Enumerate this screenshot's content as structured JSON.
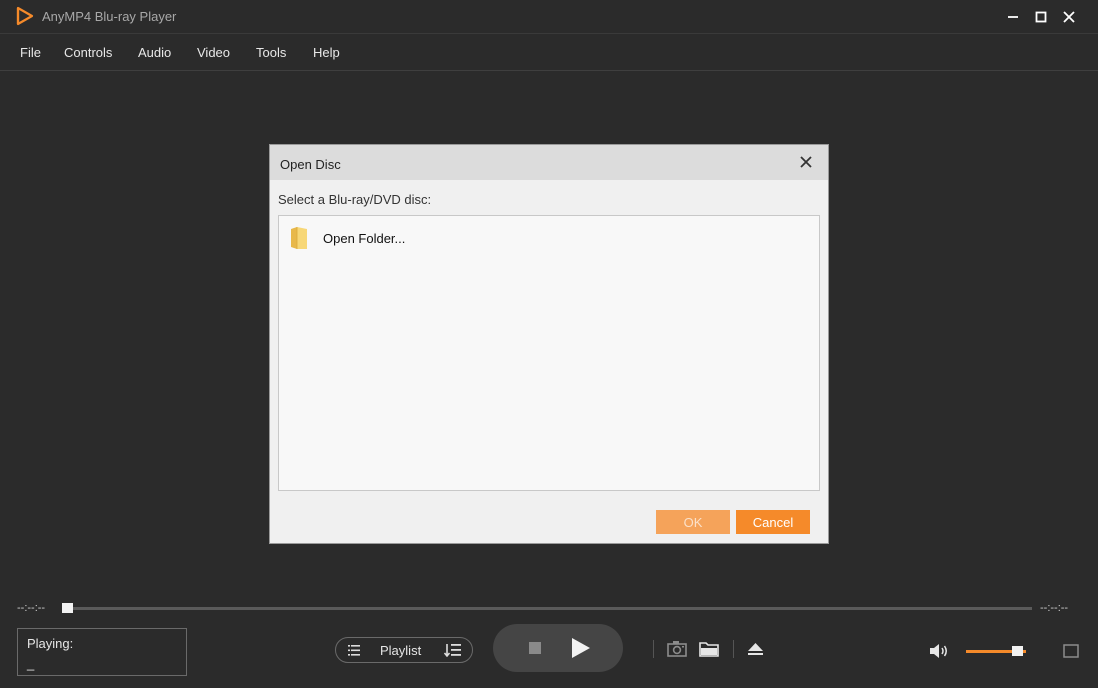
{
  "app": {
    "title": "AnyMP4 Blu-ray Player",
    "accent": "#f58a2a"
  },
  "menu": {
    "items": [
      {
        "label": "File"
      },
      {
        "label": "Controls"
      },
      {
        "label": "Audio"
      },
      {
        "label": "Video"
      },
      {
        "label": "Tools"
      },
      {
        "label": "Help"
      }
    ]
  },
  "dialog": {
    "title": "Open Disc",
    "prompt": "Select a Blu-ray/DVD disc:",
    "items": [
      {
        "label": "Open Folder...",
        "icon": "folder-icon"
      }
    ],
    "ok_label": "OK",
    "cancel_label": "Cancel"
  },
  "seek": {
    "current_time": "--:--:--",
    "total_time": "--:--:--",
    "progress": 0
  },
  "now_playing": {
    "label": "Playing:",
    "value": "_"
  },
  "playlist": {
    "label": "Playlist"
  },
  "volume": {
    "level": 0.85
  },
  "icons": [
    "app-logo-icon",
    "minimize-icon",
    "maximize-icon",
    "close-icon",
    "folder-icon",
    "list-icon",
    "sort-icon",
    "stop-icon",
    "play-icon",
    "camera-icon",
    "open-folder-icon",
    "eject-icon",
    "volume-icon",
    "fullscreen-icon"
  ]
}
